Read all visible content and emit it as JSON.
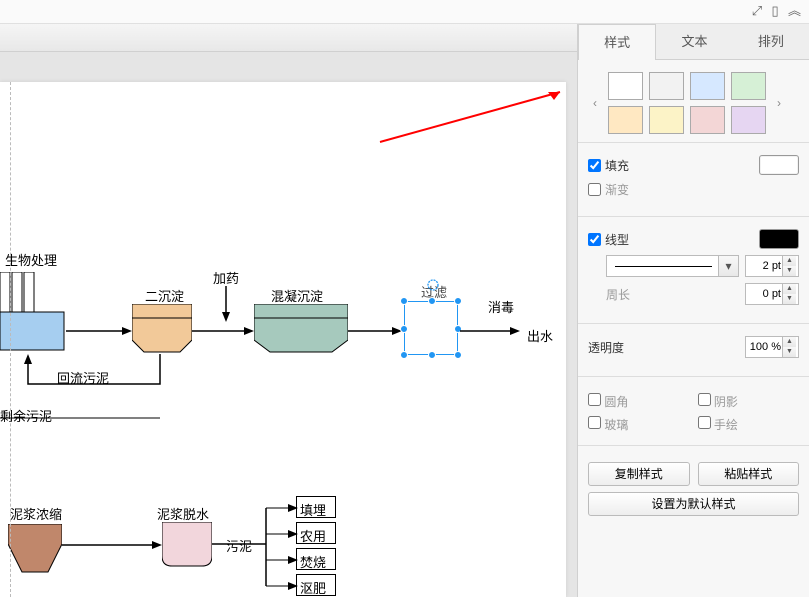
{
  "window_controls": {
    "expand": "⤢",
    "panel": "▯",
    "collapse": "︽"
  },
  "tabs": {
    "style": "样式",
    "text": "文本",
    "arrange": "排列"
  },
  "swatches_row1": [
    "#ffffff",
    "#f2f2f2",
    "#d6e8ff",
    "#d6f0d6"
  ],
  "swatches_row2": [
    "#ffe8c2",
    "#fcf3c7",
    "#f3d6d6",
    "#e6d6f2"
  ],
  "fill": {
    "label": "填充",
    "color": "#ffffff"
  },
  "gradient": {
    "label": "渐变"
  },
  "line": {
    "label": "线型",
    "color": "#000000",
    "width": "2 pt"
  },
  "perimeter": {
    "label": "周长",
    "value": "0 pt"
  },
  "opacity": {
    "label": "透明度",
    "value": "100 %"
  },
  "rounded": {
    "label": "圆角"
  },
  "shadow": {
    "label": "阴影"
  },
  "glass": {
    "label": "玻璃"
  },
  "sketch": {
    "label": "手绘"
  },
  "copy_style": "复制样式",
  "paste_style": "粘贴样式",
  "set_default": "设置为默认样式",
  "diagram": {
    "bio": "生物处理",
    "sed2": "二沉淀",
    "dose": "加药",
    "coag": "混凝沉淀",
    "filter": "过滤",
    "disinfect": "消毒",
    "effluent": "出水",
    "return_sludge": "回流污泥",
    "excess_sludge": "剩余污泥",
    "thicken": "泥浆浓缩",
    "dewater": "泥浆脱水",
    "sludge": "污泥",
    "landfill": "填埋",
    "farm": "农用",
    "incinerate": "焚烧",
    "fertilizer": "沤肥"
  }
}
